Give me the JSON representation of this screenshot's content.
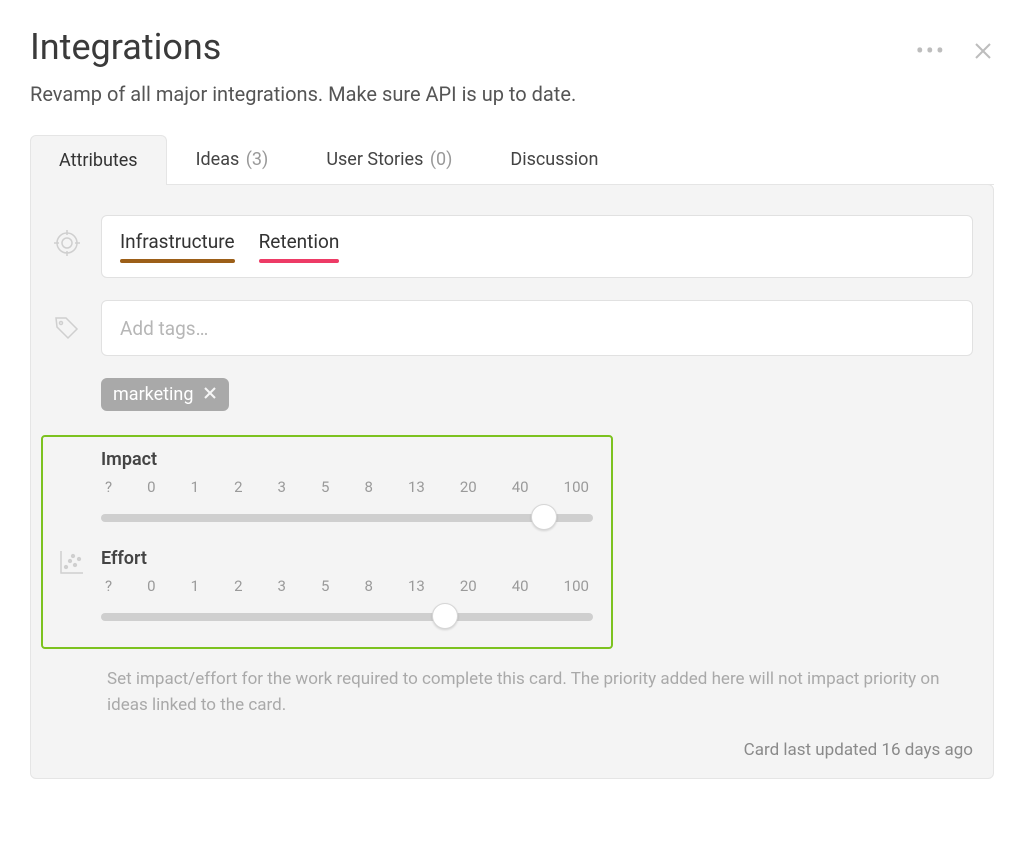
{
  "header": {
    "title": "Integrations",
    "subtitle": "Revamp of all major integrations. Make sure API is up to date."
  },
  "tabs": {
    "attributes": {
      "label": "Attributes"
    },
    "ideas": {
      "label": "Ideas",
      "count": "(3)"
    },
    "stories": {
      "label": "User Stories",
      "count": "(0)"
    },
    "discussion": {
      "label": "Discussion"
    }
  },
  "categories": [
    {
      "name": "Infrastructure",
      "color": "brown"
    },
    {
      "name": "Retention",
      "color": "pink"
    }
  ],
  "tags_input": {
    "placeholder": "Add tags…"
  },
  "tags": [
    {
      "name": "marketing"
    }
  ],
  "sliders": {
    "ticks": [
      "?",
      "0",
      "1",
      "2",
      "3",
      "5",
      "8",
      "13",
      "20",
      "40",
      "100"
    ],
    "impact": {
      "label": "Impact",
      "value_index": 9
    },
    "effort": {
      "label": "Effort",
      "value_index": 7
    }
  },
  "help_text": "Set impact/effort for the work required to complete this card. The priority added here will not impact priority on ideas linked to the card.",
  "footer": {
    "updated": "Card last updated 16 days ago"
  }
}
